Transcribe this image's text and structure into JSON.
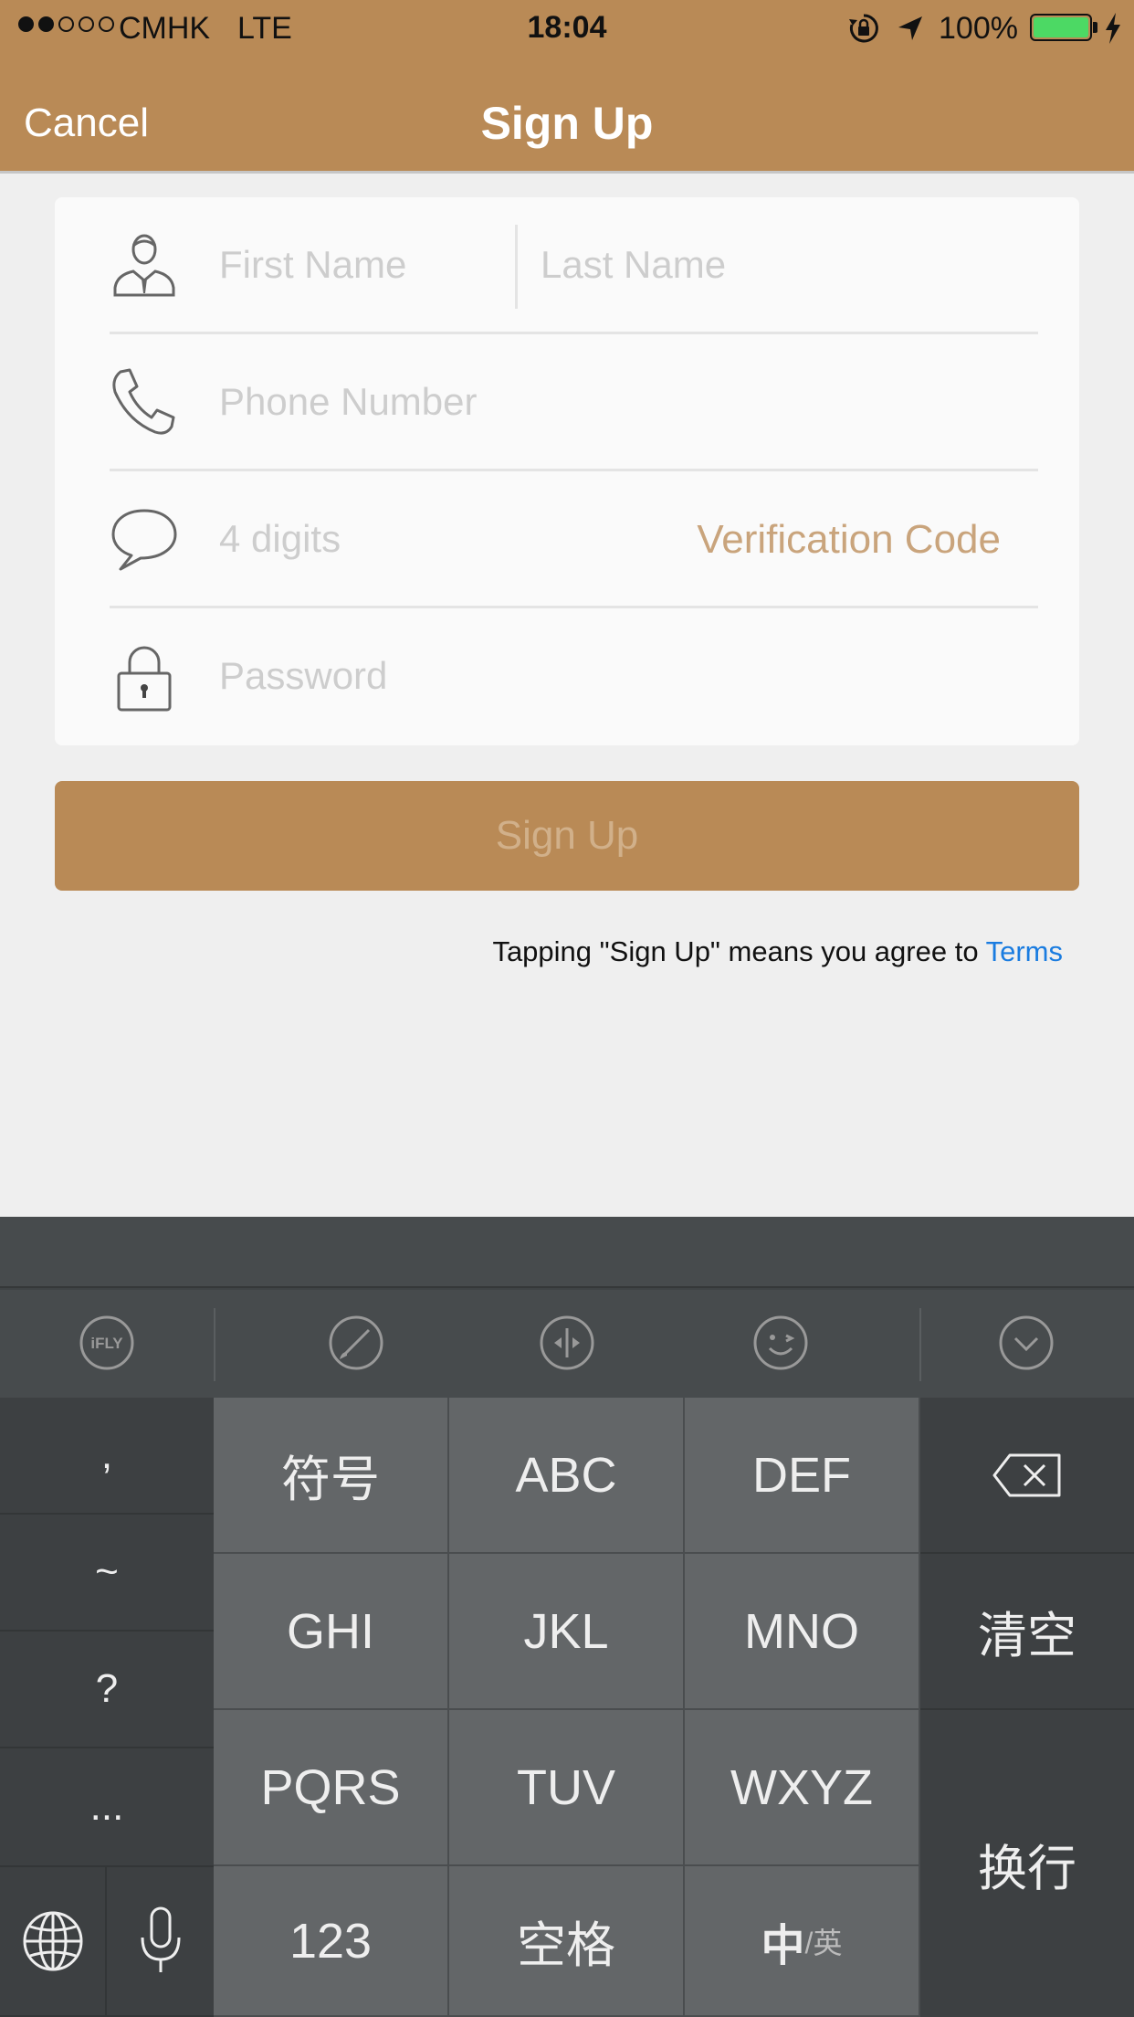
{
  "status_bar": {
    "carrier": "CMHK",
    "network": "LTE",
    "time": "18:04",
    "battery": "100%",
    "battery_color": "#4cd964"
  },
  "nav": {
    "cancel_label": "Cancel",
    "title": "Sign Up"
  },
  "theme": {
    "accent": "#b98a56",
    "link": "#1a7ce0"
  },
  "form": {
    "first_name_placeholder": "First Name",
    "last_name_placeholder": "Last Name",
    "phone_placeholder": "Phone Number",
    "code_placeholder": "4 digits",
    "verification_label": "Verification Code",
    "password_placeholder": "Password",
    "icons": [
      "user-icon",
      "phone-icon",
      "speech-bubble-icon",
      "lock-icon"
    ]
  },
  "signup_button_label": "Sign Up",
  "terms": {
    "text": "Tapping \"Sign Up\" means you agree to ",
    "link": "Terms"
  },
  "keyboard": {
    "toolbar_icons": [
      "ifly-icon",
      "brush-icon",
      "cursor-move-icon",
      "emoji-icon",
      "collapse-icon"
    ],
    "ifly_label": "iFLY",
    "left_keys": [
      ",",
      "~",
      "?",
      "..."
    ],
    "grid": [
      [
        "符号",
        "ABC",
        "DEF"
      ],
      [
        "GHI",
        "JKL",
        "MNO"
      ],
      [
        "PQRS",
        "TUV",
        "WXYZ"
      ],
      [
        "123",
        "空格",
        ""
      ]
    ],
    "lang_switch_main": "中",
    "lang_switch_sub": "/英",
    "right_keys": [
      "清空",
      "换行"
    ],
    "bottom_left_icons": [
      "globe-icon",
      "microphone-icon"
    ],
    "backspace_icon": "backspace-icon"
  }
}
